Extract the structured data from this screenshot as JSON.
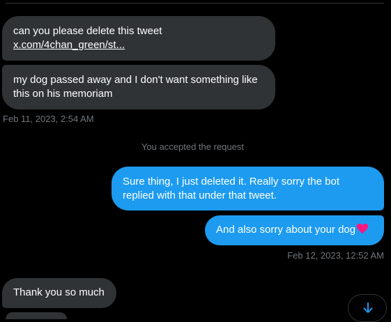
{
  "conversation": {
    "incoming_1": {
      "line1": "can you please delete this tweet",
      "link": "x.com/4chan_green/st..."
    },
    "incoming_2": {
      "line1": "my dog passed away and I don't want something like",
      "line2": "this on his memoriam"
    },
    "timestamp_1": "Feb 11, 2023, 2:54 AM",
    "system_note": "You accepted the request",
    "outgoing_1": {
      "line1": "Sure thing, I just deleted it. Really sorry the bot",
      "line2": "replied with that under that tweet."
    },
    "outgoing_2": {
      "text": "And also sorry about your dog",
      "emoji": "red-heart"
    },
    "timestamp_2": "Feb 12, 2023, 12:52 AM",
    "incoming_3": {
      "text": "Thank you so much"
    }
  },
  "controls": {
    "scroll_down_icon": "arrow-down-icon"
  },
  "colors": {
    "background": "#000000",
    "incoming_bubble": "#2f3336",
    "outgoing_bubble": "#1d9bf0",
    "muted_text": "#71767b",
    "heart": "#f91880"
  }
}
